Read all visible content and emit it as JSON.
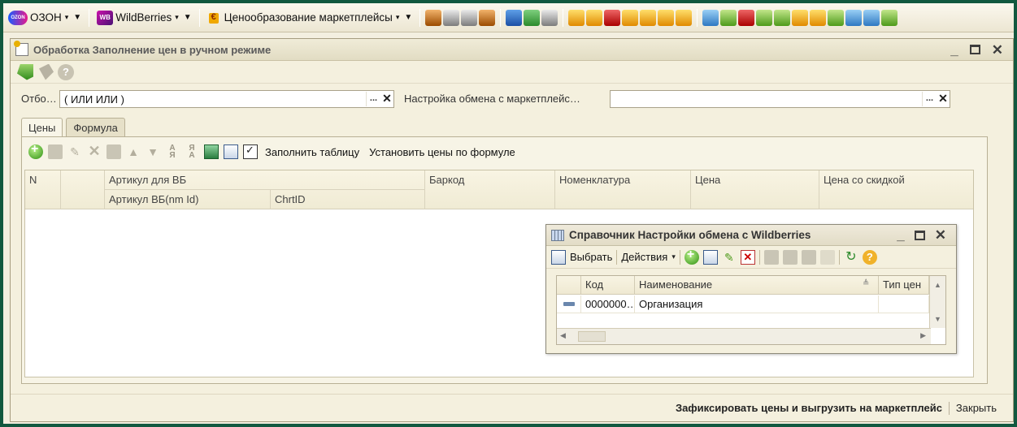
{
  "top_toolbar": {
    "ozon": {
      "label": "ОЗОН",
      "logo_text": "OZON"
    },
    "wildberries": {
      "label": "WildBerries",
      "logo_text": "WB"
    },
    "pricing": {
      "label": "Ценообразование маркетплейсы"
    }
  },
  "document": {
    "title": "Обработка  Заполнение цен в ручном режиме"
  },
  "filter": {
    "selection_label": "Отбо…",
    "selection_value": "( ИЛИ ИЛИ )",
    "exchange_label": "Настройка обмена с маркетплейс…",
    "exchange_value": ""
  },
  "tabs": [
    {
      "label": "Цены",
      "active": true
    },
    {
      "label": "Формула",
      "active": false
    }
  ],
  "table_toolbar": {
    "fill_table": "Заполнить таблицу",
    "set_prices": "Установить цены по формуле"
  },
  "grid": {
    "col_n": "N",
    "col_article_group": "Артикул для ВБ",
    "col_article_wb": "Артикул ВБ(nm Id)",
    "col_chrt": "ChrtID",
    "col_barcode": "Баркод",
    "col_nomenclature": "Номенклатура",
    "col_price": "Цена",
    "col_discount_price": "Цена со скидкой"
  },
  "catalog": {
    "title": "Справочник Настройки обмена с Wildberries",
    "select_label": "Выбрать",
    "actions_label": "Действия",
    "col_code": "Код",
    "col_name": "Наименование",
    "col_type": "Тип цен",
    "rows": [
      {
        "code": "0000000…",
        "name": "Организация",
        "type": ""
      }
    ]
  },
  "footer": {
    "commit": "Зафиксировать цены и выгрузить на маркетплейс",
    "close": "Закрыть"
  }
}
